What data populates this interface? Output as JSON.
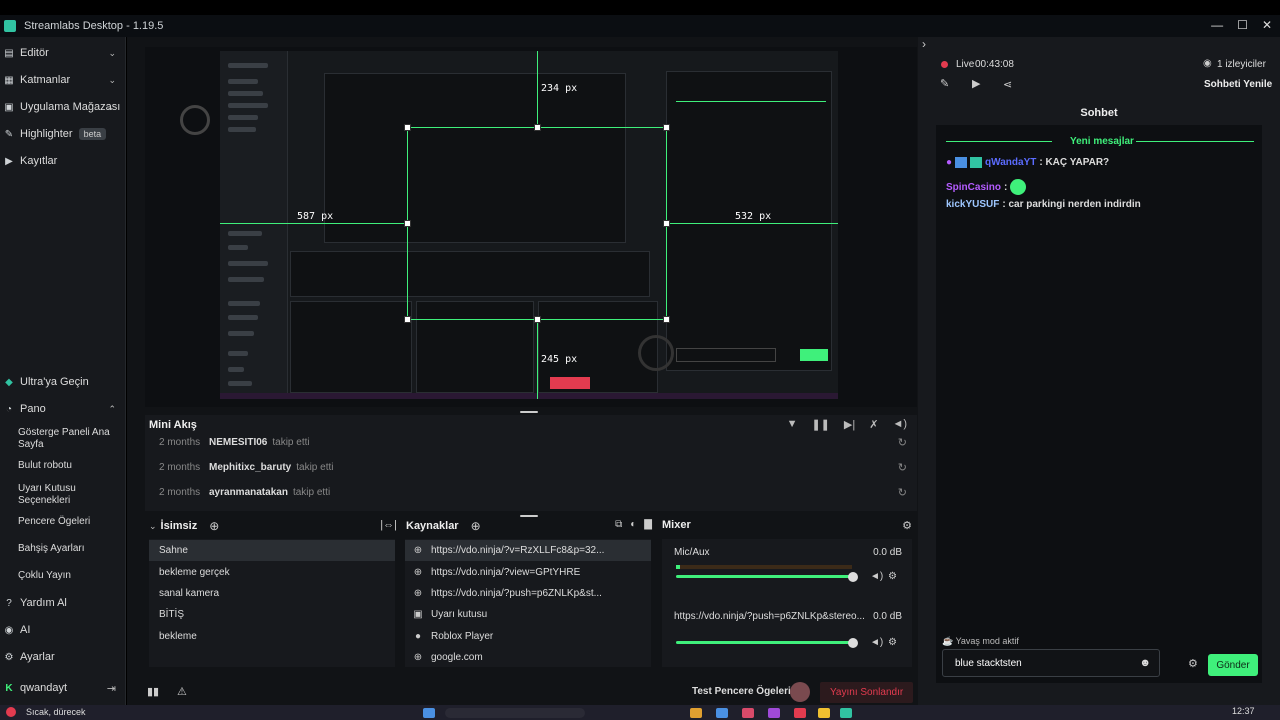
{
  "window": {
    "title": "Streamlabs Desktop - 1.19.5",
    "min": "—",
    "max": "☐",
    "close": "✕"
  },
  "sidebar": {
    "top_items": [
      {
        "label": "Editör",
        "icon": "editor-icon"
      },
      {
        "label": "Katmanlar",
        "icon": "layers-icon"
      },
      {
        "label": "Uygulama Mağazası",
        "icon": "store-icon"
      },
      {
        "label": "Highlighter",
        "icon": "highlighter-icon",
        "badge": "beta"
      },
      {
        "label": "Kayıtlar",
        "icon": "recordings-icon"
      }
    ],
    "ultra": "Ultra'ya Geçin",
    "pano": "Pano",
    "pano_sub": [
      "Gösterge Paneli Ana Sayfa",
      "Bulut robotu",
      "Uyarı Kutusu Seçenekleri",
      "Pencere Ögeleri",
      "Bahşiş Ayarları",
      "Çoklu Yayın"
    ],
    "help": "Yardım Al",
    "ai": "AI",
    "settings": "Ayarlar",
    "user": "qwandayt"
  },
  "preview": {
    "dims": [
      "234 px",
      "587 px",
      "532 px",
      "245 px"
    ]
  },
  "activity": {
    "title": "Mini Akış",
    "rows": [
      {
        "time": "2 months",
        "user": "NEMESITI06",
        "action": "takip etti"
      },
      {
        "time": "2 months",
        "user": "Mephitixc_baruty",
        "action": "takip etti"
      },
      {
        "time": "2 months",
        "user": "ayranmanatakan",
        "action": "takip etti"
      }
    ]
  },
  "scenes": {
    "title": "İsimsiz",
    "items": [
      "Sahne",
      "bekleme gerçek",
      "sanal kamera",
      "BİTİŞ",
      "bekleme"
    ]
  },
  "sources": {
    "title": "Kaynaklar",
    "items": [
      {
        "label": "https://vdo.ninja/?v=RzXLLFc8&p=32...",
        "icon": "globe-icon"
      },
      {
        "label": "https://vdo.ninja/?view=GPtYHRE",
        "icon": "globe-icon"
      },
      {
        "label": "https://vdo.ninja/?push=p6ZNLKp&st...",
        "icon": "globe-icon"
      },
      {
        "label": "Uyarı kutusu",
        "icon": "alert-box-icon"
      },
      {
        "label": "Roblox Player",
        "icon": "user-icon"
      },
      {
        "label": "google.com",
        "icon": "globe-icon"
      }
    ]
  },
  "mixer": {
    "title": "Mixer",
    "channels": [
      {
        "name": "Mic/Aux",
        "db": "0.0 dB",
        "volume": 1.0
      },
      {
        "name": "https://vdo.ninja/?push=p6ZNLKp&stereo...",
        "db": "0.0 dB",
        "volume": 1.0
      }
    ]
  },
  "footer": {
    "test_label": "Test Pencere Ögeleri",
    "end_stream": "Yayını Sonlandır"
  },
  "live": {
    "status": "Live",
    "time": "00:43:08",
    "viewers": "1 izleyiciler",
    "refresh_chat": "Sohbeti Yenile"
  },
  "chat": {
    "title": "Sohbet",
    "new_messages": "Yeni mesajlar",
    "messages": [
      {
        "user": "qWandaYT",
        "text": ": KAÇ YAPAR?",
        "color": "#5b6cff"
      },
      {
        "user": "SpinCasino",
        "text": ":",
        "color": "#b45cff"
      },
      {
        "user": "kickYUSUF",
        "text": ": car parkingi nerden indirdin",
        "color": "#9ec7ff"
      }
    ],
    "slow_mode": "Yavaş mod aktif",
    "input_value": "blue stacktsten",
    "send": "Gönder"
  },
  "taskbar": {
    "weather": "Sıcak, dürecek",
    "clock": "12:37"
  },
  "colors": {
    "accent": "#3ff07b",
    "danger": "#e33b4f",
    "live": "#e33b4f"
  }
}
